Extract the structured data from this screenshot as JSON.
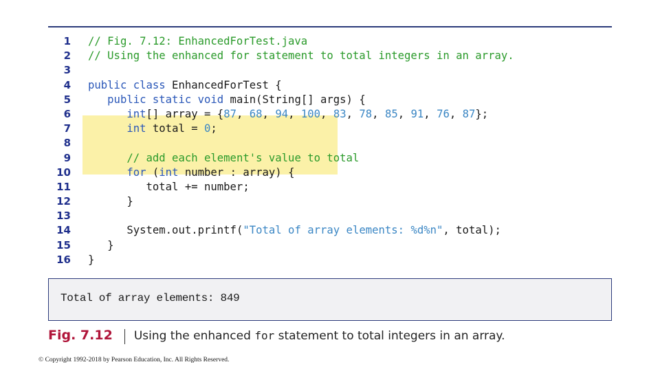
{
  "figure": {
    "code_lines": [
      {
        "n": "1",
        "indent": "",
        "segments": [
          {
            "t": "// Fig. 7.12: EnhancedForTest.java",
            "c": "cm"
          }
        ]
      },
      {
        "n": "2",
        "indent": "",
        "segments": [
          {
            "t": "// Using the enhanced for statement to total integers in an array.",
            "c": "cm"
          }
        ]
      },
      {
        "n": "3",
        "indent": "",
        "segments": []
      },
      {
        "n": "4",
        "indent": "",
        "segments": [
          {
            "t": "public class",
            "c": "kw"
          },
          {
            "t": " EnhancedForTest {",
            "c": ""
          }
        ]
      },
      {
        "n": "5",
        "indent": "   ",
        "segments": [
          {
            "t": "public static void",
            "c": "kw"
          },
          {
            "t": " main(String[] args) {",
            "c": ""
          }
        ]
      },
      {
        "n": "6",
        "indent": "      ",
        "segments": [
          {
            "t": "int",
            "c": "kw"
          },
          {
            "t": "[] array = {",
            "c": ""
          },
          {
            "t": "87",
            "c": "lit"
          },
          {
            "t": ", ",
            "c": ""
          },
          {
            "t": "68",
            "c": "lit"
          },
          {
            "t": ", ",
            "c": ""
          },
          {
            "t": "94",
            "c": "lit"
          },
          {
            "t": ", ",
            "c": ""
          },
          {
            "t": "100",
            "c": "lit"
          },
          {
            "t": ", ",
            "c": ""
          },
          {
            "t": "83",
            "c": "lit"
          },
          {
            "t": ", ",
            "c": ""
          },
          {
            "t": "78",
            "c": "lit"
          },
          {
            "t": ", ",
            "c": ""
          },
          {
            "t": "85",
            "c": "lit"
          },
          {
            "t": ", ",
            "c": ""
          },
          {
            "t": "91",
            "c": "lit"
          },
          {
            "t": ", ",
            "c": ""
          },
          {
            "t": "76",
            "c": "lit"
          },
          {
            "t": ", ",
            "c": ""
          },
          {
            "t": "87",
            "c": "lit"
          },
          {
            "t": "};",
            "c": ""
          }
        ]
      },
      {
        "n": "7",
        "indent": "      ",
        "segments": [
          {
            "t": "int",
            "c": "kw"
          },
          {
            "t": " total = ",
            "c": ""
          },
          {
            "t": "0",
            "c": "lit"
          },
          {
            "t": ";",
            "c": ""
          }
        ]
      },
      {
        "n": "8",
        "indent": "",
        "segments": []
      },
      {
        "n": "9",
        "indent": "      ",
        "segments": [
          {
            "t": "// add each element's value to total",
            "c": "cm"
          }
        ]
      },
      {
        "n": "10",
        "indent": "      ",
        "segments": [
          {
            "t": "for",
            "c": "kw"
          },
          {
            "t": " (",
            "c": ""
          },
          {
            "t": "int",
            "c": "kw"
          },
          {
            "t": " number : array) {",
            "c": ""
          }
        ]
      },
      {
        "n": "11",
        "indent": "         ",
        "segments": [
          {
            "t": "total += number;",
            "c": ""
          }
        ]
      },
      {
        "n": "12",
        "indent": "      ",
        "segments": [
          {
            "t": "}",
            "c": ""
          }
        ]
      },
      {
        "n": "13",
        "indent": "",
        "segments": []
      },
      {
        "n": "14",
        "indent": "      ",
        "segments": [
          {
            "t": "System.out.printf(",
            "c": ""
          },
          {
            "t": "\"Total of array elements: %d%n\"",
            "c": "lit"
          },
          {
            "t": ", total);",
            "c": ""
          }
        ]
      },
      {
        "n": "15",
        "indent": "   ",
        "segments": [
          {
            "t": "}",
            "c": ""
          }
        ]
      },
      {
        "n": "16",
        "indent": "",
        "segments": [
          {
            "t": "}",
            "c": ""
          }
        ]
      }
    ],
    "highlighted_lines": [
      "9",
      "10",
      "11",
      "12"
    ],
    "output": "Total of array elements: 849",
    "caption": {
      "label": "Fig. 7.12",
      "text_before": "Using the enhanced ",
      "code_word": "for",
      "text_after": " statement to total integers in an array."
    }
  },
  "footer": {
    "copyright": "© Copyright 1992-2018 by Pearson Education, Inc. All Rights Reserved."
  },
  "colors": {
    "comment": "#2a9a2a",
    "keyword": "#2a57b8",
    "literal": "#3a86c4",
    "line_number": "#1f2f8c",
    "highlight": "#fbf1a8",
    "figure_label": "#b0153a",
    "rule": "#2b3a7a"
  }
}
